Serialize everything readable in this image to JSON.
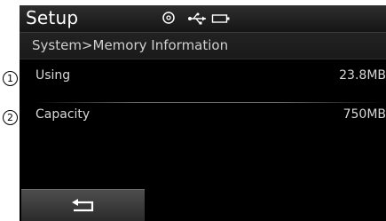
{
  "header": {
    "title": "Setup",
    "icons": [
      "disc-icon",
      "usb-icon",
      "battery-icon"
    ]
  },
  "breadcrumb": "System>Memory Information",
  "rows": [
    {
      "marker": "1",
      "label": "Using",
      "value": "23.8MB"
    },
    {
      "marker": "2",
      "label": "Capacity",
      "value": "750MB"
    }
  ],
  "footer": {
    "back_icon": "back-arrow-icon"
  }
}
